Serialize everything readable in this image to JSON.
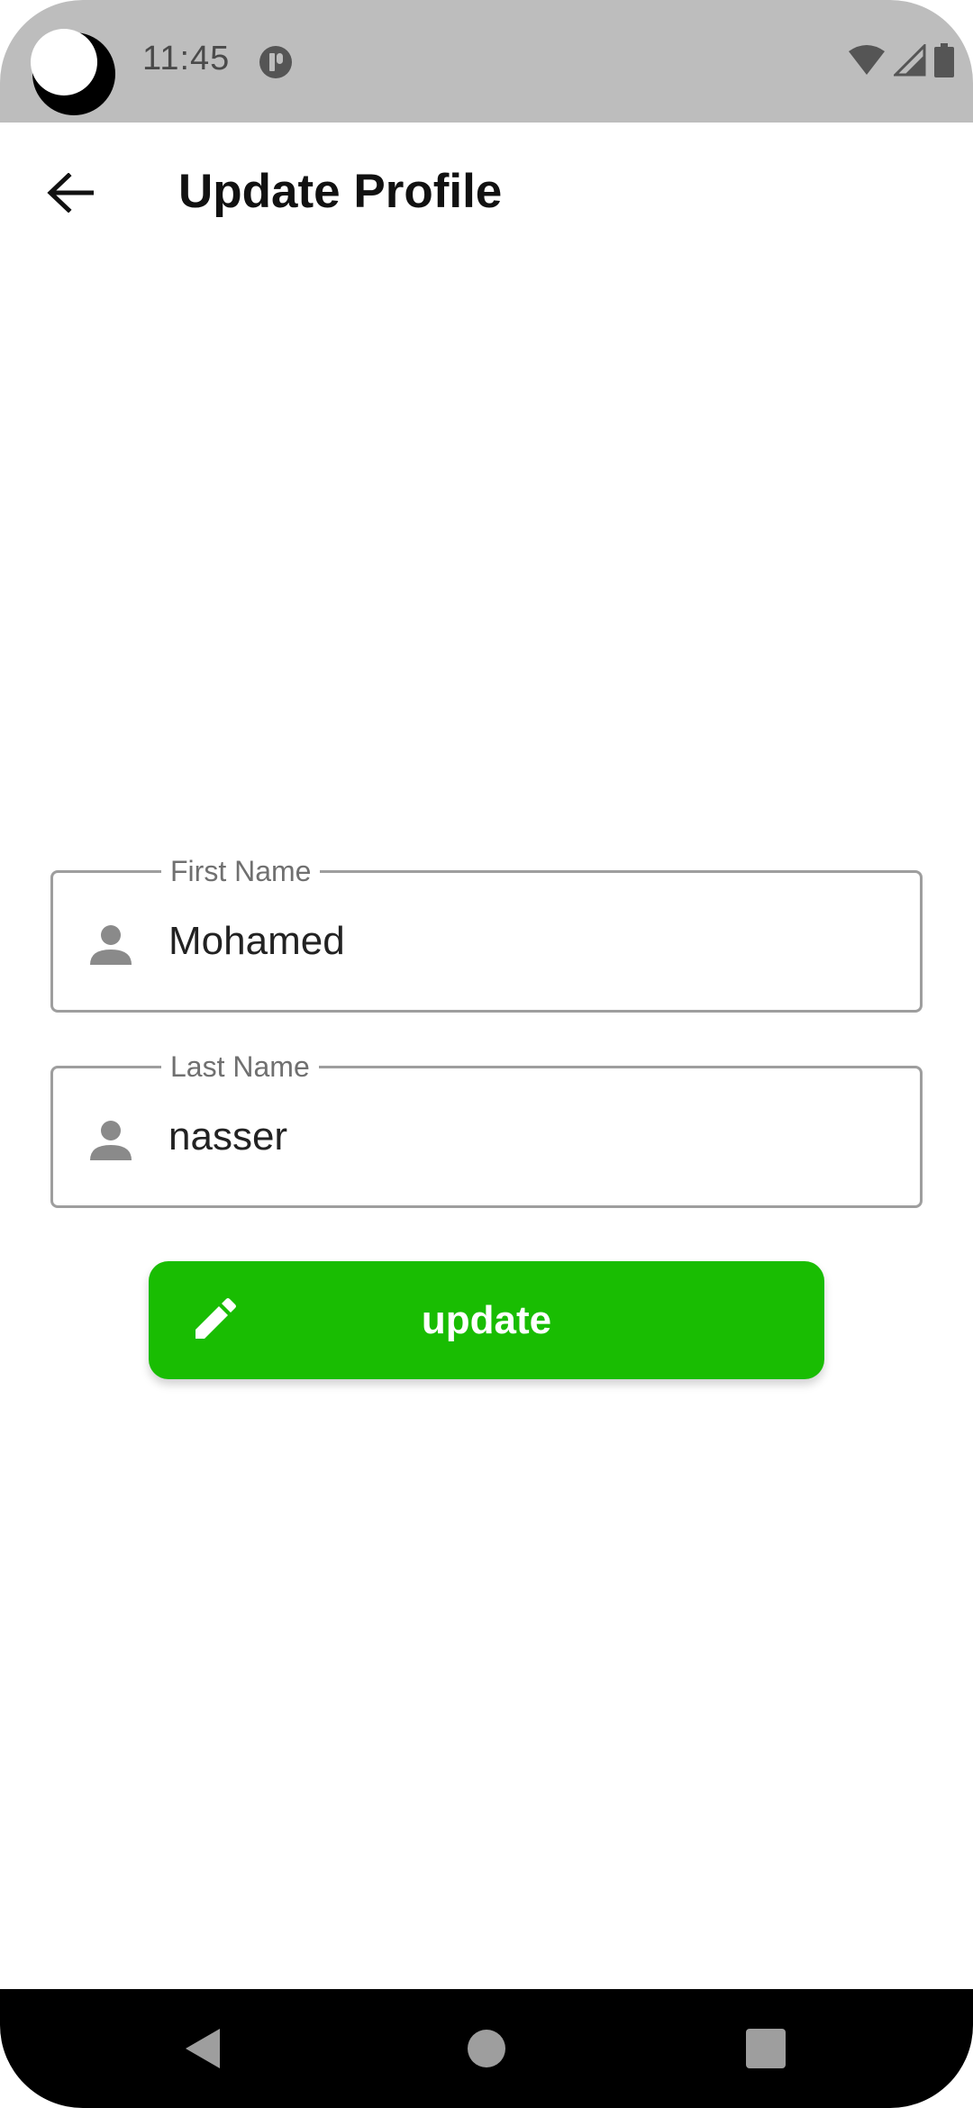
{
  "status_bar": {
    "time": "11:45",
    "icons": [
      "moon-cutout-icon",
      "app-notification-icon",
      "wifi-icon",
      "cellular-signal-icon",
      "battery-icon"
    ]
  },
  "app_bar": {
    "title": "Update Profile",
    "back_icon": "arrow-left-icon"
  },
  "form": {
    "first_name": {
      "label": "First Name",
      "value": "Mohamed",
      "icon": "person-icon"
    },
    "last_name": {
      "label": "Last Name",
      "value": "nasser",
      "icon": "person-icon"
    },
    "submit": {
      "label": "update",
      "icon": "pencil-icon",
      "color": "#19bd02"
    }
  },
  "nav_bar": {
    "buttons": [
      "back-triangle-icon",
      "home-circle-icon",
      "recents-square-icon"
    ]
  }
}
